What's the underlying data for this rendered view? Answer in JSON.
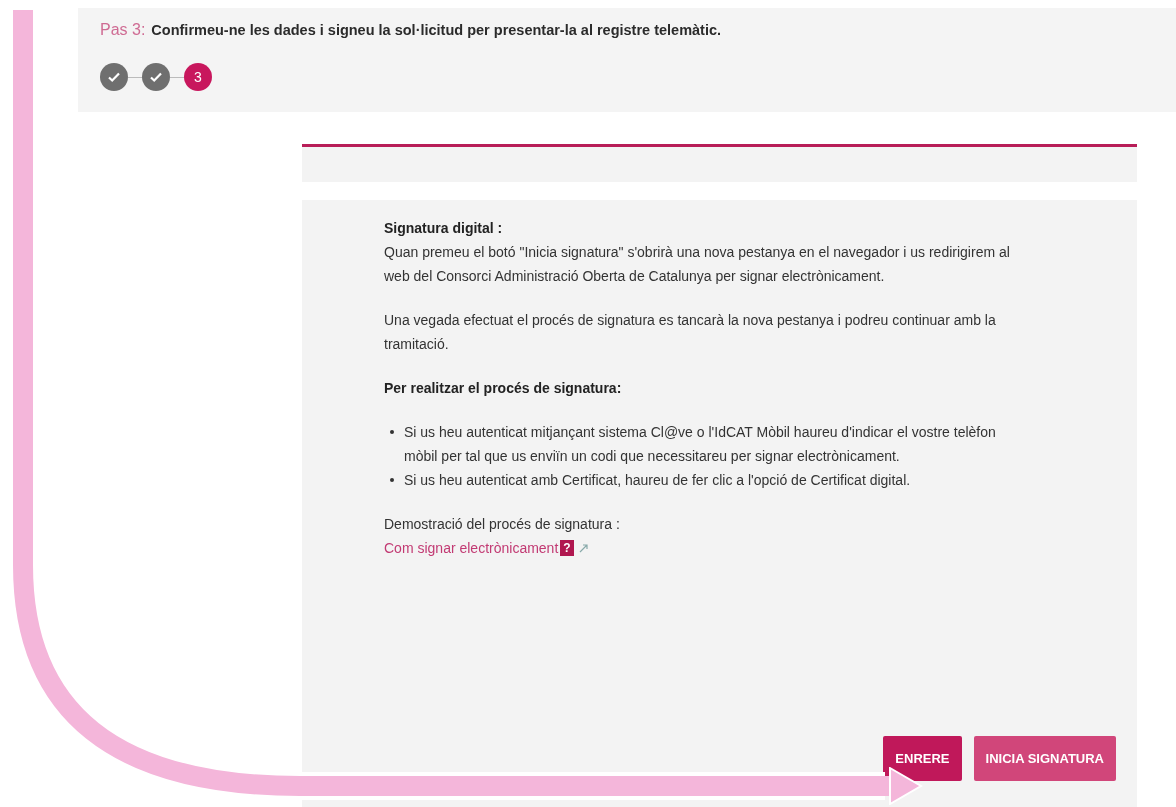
{
  "step_header": {
    "label": "Pas 3:",
    "text": "Confirmeu-ne les dades i signeu la sol·licitud per presentar-la al registre telemàtic."
  },
  "steps": [
    {
      "kind": "done"
    },
    {
      "kind": "done"
    },
    {
      "kind": "current",
      "label": "3"
    }
  ],
  "signature_panel": {
    "title": "Signatura digital :",
    "paragraphs": [
      "Quan premeu el botó \"Inicia signatura\" s'obrirà una nova pestanya en el navegador i us redirigirem al web del Consorci Administració Oberta de Catalunya per signar electrònicament.",
      "Una vegada efectuat el procés de signatura es tancarà la nova pestanya i podreu continuar amb la tramitació."
    ],
    "subheading": "Per realitzar el procés de signatura:",
    "bullets": [
      "Si us heu autenticat mitjançant sistema Cl@ve o l'IdCAT Mòbil haureu d'indicar el vostre telèfon mòbil per tal que us enviïn un codi que necessitareu per signar electrònicament.",
      "Si us heu autenticat amb Certificat, haureu de fer clic a l'opció de Certificat digital."
    ],
    "demo_label": "Demostració del procés de signatura :",
    "demo_link": {
      "text": "Com signar electrònicament",
      "help": "?"
    }
  },
  "buttons": [
    {
      "kind": "back",
      "label": "ENRERE"
    },
    {
      "kind": "primary",
      "label": "INICIA SIGNATURA"
    }
  ]
}
